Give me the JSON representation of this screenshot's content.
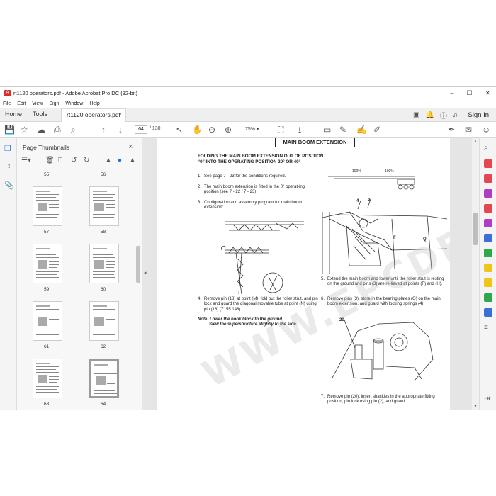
{
  "window": {
    "title": "rt1120 operators.pdf - Adobe Acrobat Pro DC (32-bit)",
    "app_icon": "acrobat-icon",
    "controls": [
      "–",
      "☐",
      "✕"
    ]
  },
  "menu": [
    "File",
    "Edit",
    "View",
    "Sign",
    "Window",
    "Help"
  ],
  "tabs": {
    "home": "Home",
    "tools": "Tools",
    "document": "rt1120 operators.pdf",
    "close": "×",
    "signin": "Sign In"
  },
  "toolbar": {
    "page_current": "64",
    "page_total": "/ 130",
    "zoom": "75%"
  },
  "panel": {
    "title": "Page Thumbnails",
    "close": "×",
    "page_labels": [
      "55",
      "56",
      "57",
      "58",
      "59",
      "60",
      "61",
      "62",
      "63",
      "64"
    ],
    "selected_page": "64"
  },
  "document": {
    "section_title": "MAIN BOOM EXTENSION",
    "heading": "FOLDING THE MAIN BOOM EXTENSION OUT OF POSITION “0” INTO THE OPERATING POSITION 20° OR 40°",
    "steps": [
      {
        "n": "1.",
        "text": "See page 7 - 23 for the conditions required."
      },
      {
        "n": "2.",
        "text": "The main boom extension is fitted in the 0° operat-ing position (see 7 - 22 / 7 - 23)."
      },
      {
        "n": "3.",
        "text": "Configuration and assembly program for main boom extension:"
      },
      {
        "n": "4.",
        "text": "Remove pin (18) at point (M), fold out the roller strut, and pin lock and guard the diagonal movable tube at point (N) using pin (18) (Z155 148)."
      },
      {
        "n": "5.",
        "text": "Extend the main boom and lower until the roller strut is resting on the ground and pins (3) are re-lieved at points (F) and (H)."
      },
      {
        "n": "6.",
        "text": "Remove pins (3), store in the bearing plates (Q) on the main boom extension, and guard with locking springs (4)."
      },
      {
        "n": "7.",
        "text": "Remove pin (20), insert shackles in the appropriate fitting position, pin lock using pin (2), and guard."
      }
    ],
    "note_line1": "Note: Lower the hook block to the ground",
    "note_line2": "Slew the superstructure slightly to the side",
    "fig_labels": {
      "a": "4",
      "b": "3",
      "c": "F",
      "d": "Q",
      "e": "20",
      "f": "100%",
      "g": "100%"
    },
    "watermark": "WWW.EPCDEPO.COM"
  }
}
